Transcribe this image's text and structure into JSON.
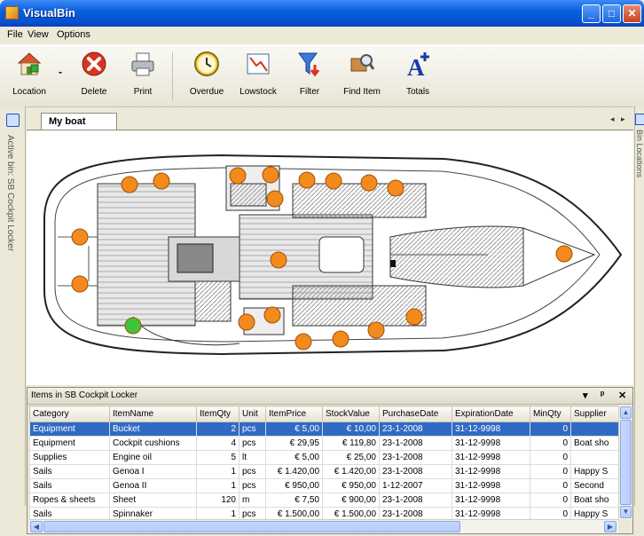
{
  "window": {
    "title": "VisualBin",
    "colors": {
      "titlebar": "#0a5fdc",
      "selection": "#316ac5",
      "marker": "#f28a1c",
      "marker_active": "#3fc43a"
    }
  },
  "menu": [
    "File",
    "View",
    "Options"
  ],
  "toolbar": [
    {
      "label": "Location",
      "icon": "location-house-icon"
    },
    {
      "label": "Delete",
      "icon": "delete-x-icon"
    },
    {
      "label": "Print",
      "icon": "printer-icon"
    },
    {
      "label": "Overdue",
      "icon": "clock-icon"
    },
    {
      "label": "Lowstock",
      "icon": "chart-icon"
    },
    {
      "label": "Filter",
      "icon": "filter-funnel-icon"
    },
    {
      "label": "Find Item",
      "icon": "find-item-icon"
    },
    {
      "label": "Totals",
      "icon": "totals-a-plus-icon"
    }
  ],
  "left_panel": {
    "label": "Active bin: SB Cockpit Locker"
  },
  "right_panel": {
    "label": "Bin Locations"
  },
  "document": {
    "tab": "My boat",
    "nav_prev": "◂",
    "nav_next": "▸"
  },
  "grid": {
    "title": "Items in SB Cockpit Locker",
    "controls": [
      "▾",
      "ᵖ",
      "✕"
    ],
    "columns": [
      "Category",
      "ItemName",
      "ItemQty",
      "Unit",
      "ItemPrice",
      "StockValue",
      "PurchaseDate",
      "ExpirationDate",
      "MinQty",
      "Supplier"
    ],
    "rows": [
      [
        "Equipment",
        "Bucket",
        "2",
        "pcs",
        "€ 5,00",
        "€ 10,00",
        "23-1-2008",
        "31-12-9998",
        "0",
        ""
      ],
      [
        "Equipment",
        "Cockpit cushions",
        "4",
        "pcs",
        "€ 29,95",
        "€ 119,80",
        "23-1-2008",
        "31-12-9998",
        "0",
        "Boat sho"
      ],
      [
        "Supplies",
        "Engine oil",
        "5",
        "lt",
        "€ 5,00",
        "€ 25,00",
        "23-1-2008",
        "31-12-9998",
        "0",
        ""
      ],
      [
        "Sails",
        "Genoa I",
        "1",
        "pcs",
        "€ 1.420,00",
        "€ 1.420,00",
        "23-1-2008",
        "31-12-9998",
        "0",
        "Happy S"
      ],
      [
        "Sails",
        "Genoa II",
        "1",
        "pcs",
        "€ 950,00",
        "€ 950,00",
        "1-12-2007",
        "31-12-9998",
        "0",
        "Second"
      ],
      [
        "Ropes & sheets",
        "Sheet",
        "120",
        "m",
        "€ 7,50",
        "€ 900,00",
        "23-1-2008",
        "31-12-9998",
        "0",
        "Boat sho"
      ],
      [
        "Sails",
        "Spinnaker",
        "1",
        "pcs",
        "€ 1.500,00",
        "€ 1.500,00",
        "23-1-2008",
        "31-12-9998",
        "0",
        "Happy S"
      ]
    ]
  }
}
